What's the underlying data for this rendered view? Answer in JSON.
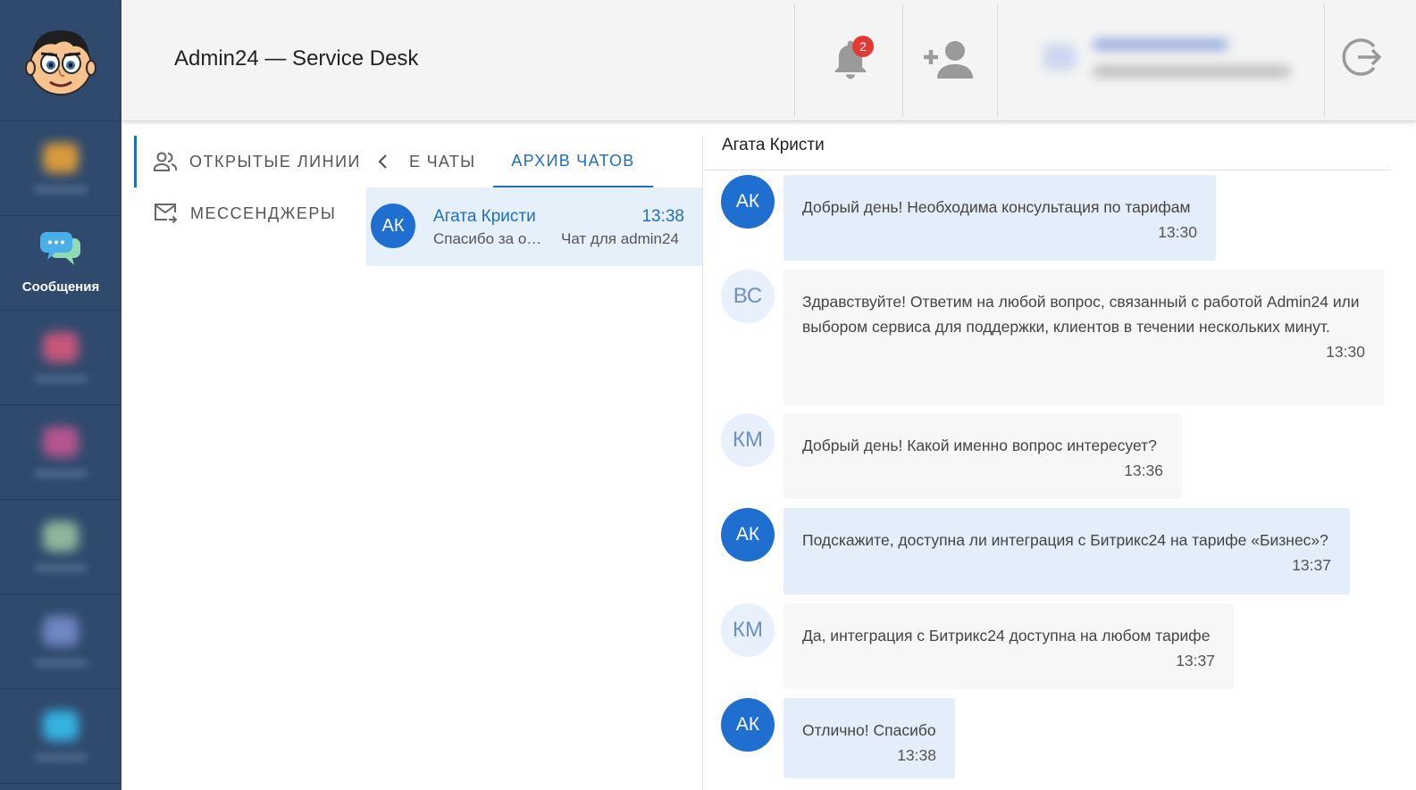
{
  "header": {
    "title": "Admin24 — Service Desk",
    "notifications_count": "2"
  },
  "sidebar": {
    "active_label": "Сообщения"
  },
  "nav": {
    "items": [
      {
        "label": "ОТКРЫТЫЕ ЛИНИИ",
        "icon": "people-icon",
        "active": true
      },
      {
        "label": "МЕССЕНДЖЕРЫ",
        "icon": "mail-forward-icon",
        "active": false
      }
    ]
  },
  "tabs": {
    "items": [
      {
        "label": "Е ЧАТЫ",
        "active": false
      },
      {
        "label": "АРХИВ ЧАТОВ",
        "active": true
      }
    ]
  },
  "chat_list": [
    {
      "initials": "АК",
      "name": "Агата Кристи",
      "time": "13:38",
      "preview": "Спасибо за обращение",
      "subtitle": "Чат для admin24"
    }
  ],
  "conversation": {
    "title": "Агата Кристи",
    "messages": [
      {
        "initials": "АК",
        "sender": "client",
        "text": "Добрый день! Необходима консультация по тарифам",
        "time": "13:30"
      },
      {
        "initials": "ВС",
        "sender": "staff",
        "text": "Здравствуйте! Ответим на любой вопрос, связанный с работой Admin24 или выбором сервиса для поддержки, клиентов в течении нескольких минут.",
        "time": "13:30"
      },
      {
        "initials": "КМ",
        "sender": "staff",
        "text": "Добрый день! Какой именно вопрос интересует?",
        "time": "13:36"
      },
      {
        "initials": "АК",
        "sender": "client",
        "text": "Подскажите, доступна ли интеграция с Битрикс24 на тарифе «Бизнес»?",
        "time": "13:37"
      },
      {
        "initials": "КМ",
        "sender": "staff",
        "text": "Да, интеграция с Битрикс24 доступна на любом тарифе",
        "time": "13:37"
      },
      {
        "initials": "АК",
        "sender": "client",
        "text": "Отлично! Спасибо",
        "time": "13:38"
      }
    ]
  },
  "colors": {
    "accent": "#1e6fbf",
    "sidebar_bg": "#2f4a6d",
    "badge": "#e53935",
    "client_bubble": "#e3eefa",
    "staff_bubble": "#f7f7f7"
  }
}
